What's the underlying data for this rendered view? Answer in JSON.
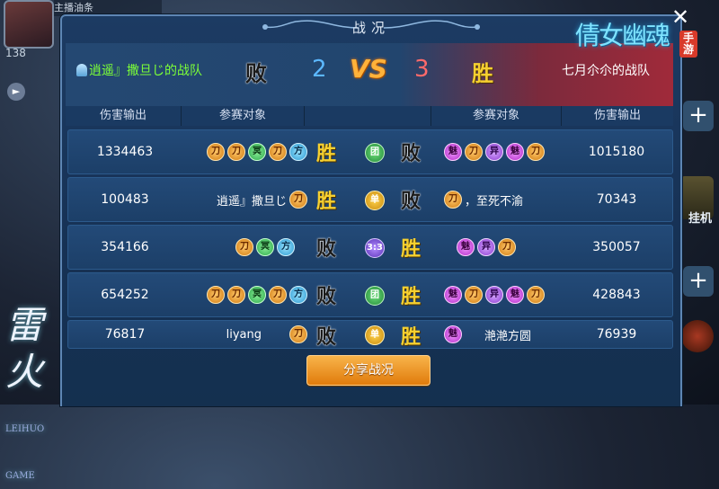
{
  "background": {
    "avatar_count": "138",
    "topbar_text": "主播油条",
    "right_label": "挂机",
    "corner_logo": "雷火",
    "corner_logo_sub": "LEIHUO GAME"
  },
  "logo": {
    "title": "倩女幽魂",
    "sub": "手游"
  },
  "panel": {
    "title": "战况"
  },
  "summary": {
    "left_team": "逍遥』撒旦じ的战队",
    "left_result": "败",
    "left_score": "2",
    "vs": "VS",
    "right_score": "3",
    "right_result": "胜",
    "right_team": "七月尒尒的战队"
  },
  "headers": [
    "伤害输出",
    "参赛对象",
    "",
    "参赛对象",
    "伤害输出"
  ],
  "icons": {
    "dao": "刀",
    "ming": "冥",
    "fang": "方",
    "mei": "魅",
    "yi": "异"
  },
  "rows": [
    {
      "left_damage": "1334463",
      "left_name": "",
      "left_result": "胜",
      "mode": "团",
      "right_result": "败",
      "right_name": "",
      "right_damage": "1015180"
    },
    {
      "left_damage": "100483",
      "left_name": "逍遥』撒旦じ",
      "left_result": "胜",
      "mode": "单",
      "right_result": "败",
      "right_name": "，至死不渝",
      "right_damage": "70343"
    },
    {
      "left_damage": "354166",
      "left_name": "",
      "left_result": "败",
      "mode": "3:3",
      "right_result": "胜",
      "right_name": "",
      "right_damage": "350057"
    },
    {
      "left_damage": "654252",
      "left_name": "",
      "left_result": "败",
      "mode": "团",
      "right_result": "胜",
      "right_name": "",
      "right_damage": "428843"
    },
    {
      "left_damage": "76817",
      "left_name": "liyang",
      "left_result": "败",
      "mode": "单",
      "right_result": "胜",
      "right_name": "滟滟方圆",
      "right_damage": "76939"
    }
  ],
  "share_button": "分享战况"
}
